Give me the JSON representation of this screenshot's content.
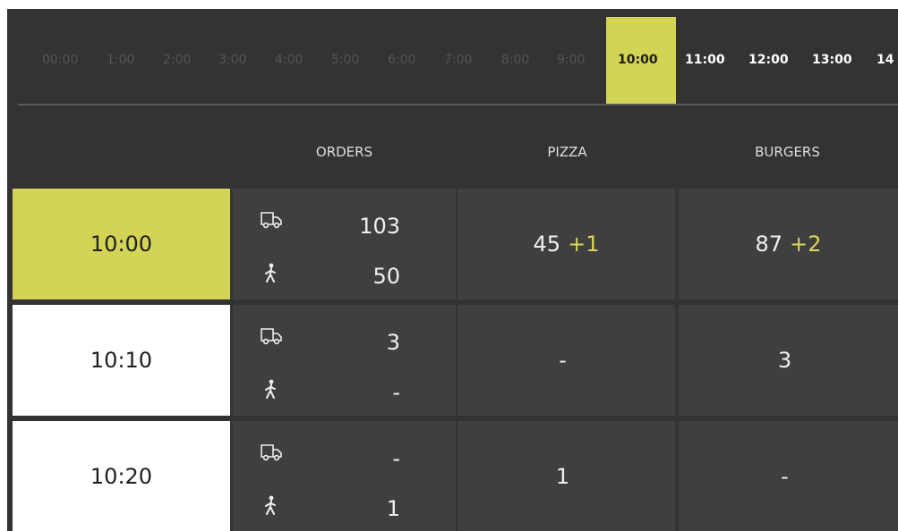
{
  "timeline": {
    "hours": [
      "00:00",
      "1:00",
      "2:00",
      "3:00",
      "4:00",
      "5:00",
      "6:00",
      "7:00",
      "8:00",
      "9:00",
      "10:00",
      "11:00",
      "12:00",
      "13:00",
      "14"
    ],
    "current": "10:00"
  },
  "columns": {
    "orders": "ORDERS",
    "pizza": "PIZZA",
    "burgers": "BURGERS"
  },
  "rows": [
    {
      "time": "10:00",
      "active": true,
      "delivery": "103",
      "walkin": "50",
      "pizza": "45",
      "pizza_plus": "+1",
      "burgers": "87",
      "burgers_plus": "+2"
    },
    {
      "time": "10:10",
      "active": false,
      "delivery": "3",
      "walkin": "-",
      "pizza": "-",
      "pizza_plus": "",
      "burgers": "3",
      "burgers_plus": ""
    },
    {
      "time": "10:20",
      "active": false,
      "delivery": "-",
      "walkin": "1",
      "pizza": "1",
      "pizza_plus": "",
      "burgers": "-",
      "burgers_plus": ""
    }
  ],
  "icons": {
    "delivery": "delivery-truck-icon",
    "walkin": "walking-person-icon"
  }
}
